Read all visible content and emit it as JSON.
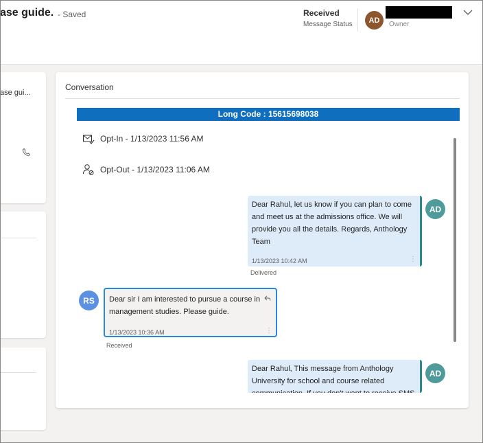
{
  "header": {
    "title": "ase guide.",
    "saved": "- Saved",
    "status_value": "Received",
    "status_label": "Message Status",
    "owner_initials": "AD",
    "owner_label": "Owner"
  },
  "left": {
    "card1_text": "ase gui..."
  },
  "conversation": {
    "title": "Conversation",
    "long_code": "Long Code : 15615698038",
    "opt_in": "Opt-In - 1/13/2023 11:56 AM",
    "opt_out": "Opt-Out - 1/13/2023 11:06 AM",
    "messages": [
      {
        "line1": "Dear Rahul, let us know if you can plan to come",
        "line2": "and meet us at the admissions office. We will",
        "line3": "provide you all the details. Regards, Anthology",
        "line4": "Team",
        "time": "1/13/2023 10:42 AM",
        "status": "Delivered",
        "initials": "AD"
      },
      {
        "line1": "Dear sir I am interested to pursue a course in",
        "line2": "management studies. Please guide.",
        "time": "1/13/2023 10:36 AM",
        "status": "Received",
        "initials": "RS"
      },
      {
        "line1": "Dear Rahul, This message from Anthology",
        "line2": "University for school and course related",
        "line3": "communication. If you don't want to receive SMS",
        "initials": "AD"
      }
    ]
  },
  "colors": {
    "accent": "#106ebe",
    "outgoing_bubble": "#deecf9",
    "owner_avatar": "#8e562e",
    "agent_avatar": "#4f9a9a",
    "contact_avatar": "#5b91e0"
  }
}
